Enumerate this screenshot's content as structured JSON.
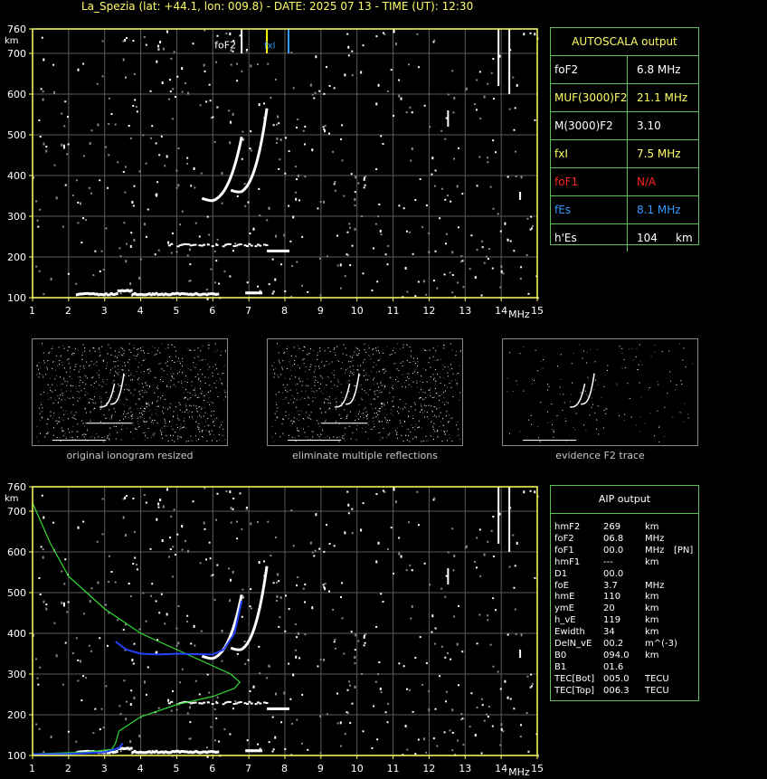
{
  "header": {
    "title": "La_Spezia (lat: +44.1, lon: 009.8) - DATE: 2025 07 13 - TIME (UT): 12:30"
  },
  "ionogram": {
    "y_ticks": [
      "760",
      "700",
      "600",
      "500",
      "400",
      "300",
      "200",
      "100"
    ],
    "y_unit": "km",
    "x_ticks": [
      "1",
      "2",
      "3",
      "4",
      "5",
      "6",
      "7",
      "8",
      "9",
      "10",
      "11",
      "12",
      "13",
      "14",
      "15"
    ],
    "x_unit": "MHz",
    "marker_labels": {
      "foF2": "foF2",
      "fxI": "fxI"
    },
    "colors": {
      "axis": "#ffff66",
      "grid": "#5a5a5a",
      "trace": "#ffffff",
      "foF2_marker": "#ffff00",
      "fxI_marker": "#3399ff",
      "profile": "#33dd33",
      "reconstructed": "#2244ff"
    }
  },
  "autoscala": {
    "title": "AUTOSCALA output",
    "rows": [
      {
        "label": "foF2",
        "value": "6.8 MHz",
        "color": "#ffffff"
      },
      {
        "label": "MUF(3000)F2",
        "value": "21.1 MHz",
        "color": "#ffff66"
      },
      {
        "label": "M(3000)F2",
        "value": "3.10",
        "color": "#ffffff"
      },
      {
        "label": "fxI",
        "value": "7.5 MHz",
        "color": "#ffff66"
      },
      {
        "label": "foF1",
        "value": "N/A",
        "color": "#ff2020"
      },
      {
        "label": "fEs",
        "value": "8.1 MHz",
        "color": "#3399ff"
      },
      {
        "label": "h'Es",
        "value": "104",
        "unit": "km",
        "color": "#ffffff"
      }
    ]
  },
  "thumbnails": [
    {
      "caption": "original ionogram resized"
    },
    {
      "caption": "eliminate multiple reflections"
    },
    {
      "caption": "evidence F2 trace"
    }
  ],
  "aip": {
    "title": "AIP output",
    "rows": [
      {
        "name": "hmF2",
        "value": "269",
        "unit": "km",
        "extra": ""
      },
      {
        "name": "foF2",
        "value": "06.8",
        "unit": "MHz",
        "extra": ""
      },
      {
        "name": "foF1",
        "value": "00.0",
        "unit": "MHz",
        "extra": "[PN]"
      },
      {
        "name": "hmF1",
        "value": "---",
        "unit": "km",
        "extra": ""
      },
      {
        "name": "D1",
        "value": "00.0",
        "unit": "",
        "extra": ""
      },
      {
        "name": "foE",
        "value": "3.7",
        "unit": "MHz",
        "extra": ""
      },
      {
        "name": "hmE",
        "value": "110",
        "unit": "km",
        "extra": ""
      },
      {
        "name": "ymE",
        "value": "20",
        "unit": "km",
        "extra": ""
      },
      {
        "name": "h_vE",
        "value": "119",
        "unit": "km",
        "extra": ""
      },
      {
        "name": "Ewidth",
        "value": "34",
        "unit": "km",
        "extra": ""
      },
      {
        "name": "DelN_vE",
        "value": "00.2",
        "unit": "m^(-3)",
        "extra": ""
      },
      {
        "name": "B0",
        "value": "094.0",
        "unit": "km",
        "extra": ""
      },
      {
        "name": "B1",
        "value": "01.6",
        "unit": "",
        "extra": ""
      },
      {
        "name": "TEC[Bot]",
        "value": "005.0",
        "unit": "TECU",
        "extra": ""
      },
      {
        "name": "TEC[Top]",
        "value": "006.3",
        "unit": "TECU",
        "extra": ""
      }
    ]
  }
}
